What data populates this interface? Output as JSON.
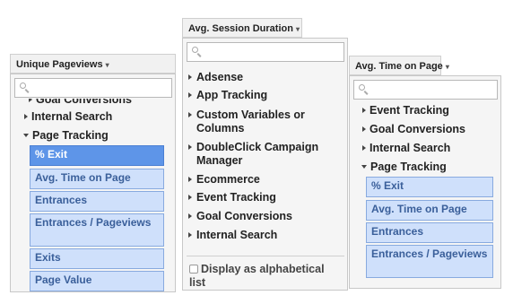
{
  "left": {
    "header": "Unique Pageviews",
    "items": [
      "Goal Conversions",
      "Internal Search",
      "Page Tracking"
    ],
    "subitems": [
      "% Exit",
      "Avg. Time on Page",
      "Entrances",
      "Entrances / Pageviews",
      "Exits",
      "Page Value"
    ]
  },
  "middle": {
    "header": "Avg. Session Duration",
    "items": [
      "Adsense",
      "App Tracking",
      "Custom Variables or Columns",
      "DoubleClick Campaign Manager",
      "Ecommerce",
      "Event Tracking",
      "Goal Conversions",
      "Internal Search"
    ],
    "checkbox_label": "Display as alphabetical list"
  },
  "right": {
    "header": "Avg. Time on Page",
    "items": [
      "Event Tracking",
      "Goal Conversions",
      "Internal Search",
      "Page Tracking"
    ],
    "subitems": [
      "% Exit",
      "Avg. Time on Page",
      "Entrances",
      "Entrances / Pageviews"
    ]
  },
  "colors": {
    "selected": "#5e95e8",
    "subitem_bg": "#cfe0fb",
    "subitem_text": "#3a5f9a"
  }
}
